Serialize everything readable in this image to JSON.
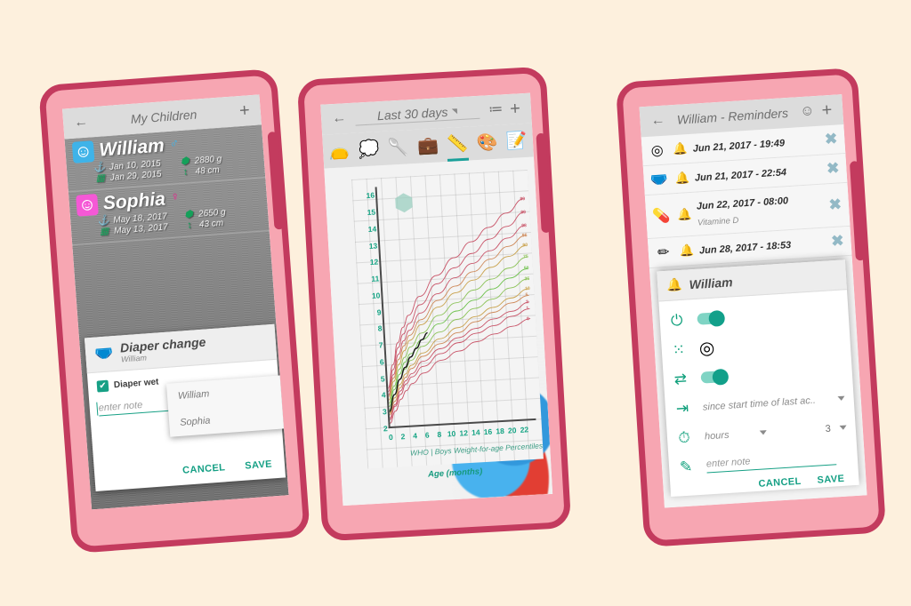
{
  "theme": {
    "background": "#FDF0DD",
    "phone_body": "#F7A6B2",
    "phone_border": "#C33B5E",
    "accent_teal": "#16A085",
    "accent_green": "#15A05A",
    "boy_blue": "#3FB3E8",
    "girl_pink": "#F558D6"
  },
  "phone1": {
    "appbar": {
      "back_icon": "←",
      "title": "My Children",
      "add_icon": "+"
    },
    "children": [
      {
        "avatar_icon": "baby-face-boy",
        "name": "William",
        "gender_symbol": "♂",
        "gender": "m",
        "birth_icon": "birth-icon",
        "birth_date": "Jan 10, 2015",
        "due_icon": "calendar-icon",
        "due_date": "Jan 29, 2015",
        "weight_icon": "weight-icon",
        "weight": "2880 g",
        "height_icon": "height-icon",
        "height": "48 cm"
      },
      {
        "avatar_icon": "baby-face-girl",
        "name": "Sophia",
        "gender_symbol": "♀",
        "gender": "f",
        "birth_icon": "birth-icon",
        "birth_date": "May 18, 2017",
        "due_icon": "calendar-icon",
        "due_date": "May 13, 2017",
        "weight_icon": "weight-icon",
        "weight": "2650 g",
        "height_icon": "height-icon",
        "height": "43 cm"
      }
    ],
    "dialog": {
      "icon": "diaper-icon",
      "title": "Diaper change",
      "subtitle": "William",
      "checkbox_label": "Diaper wet",
      "checkbox_checked": true,
      "check_glyph": "✔",
      "note_placeholder": "enter note",
      "tool_icons": [
        "baby-face-icon",
        "history-clock-icon"
      ],
      "cancel_label": "CANCEL",
      "save_label": "SAVE",
      "dropdown_options": [
        "William",
        "Sophia"
      ]
    }
  },
  "phone2": {
    "appbar": {
      "back_icon": "←",
      "title": "Last 30 days",
      "list_icon": "≔",
      "add_icon": "+"
    },
    "tabs": [
      {
        "name": "diaper-tab",
        "glyph": "👝"
      },
      {
        "name": "sleep-tab",
        "glyph": "💭"
      },
      {
        "name": "feeding-tab",
        "glyph": "🥄"
      },
      {
        "name": "health-tab",
        "glyph": "💼"
      },
      {
        "name": "measure-tab",
        "glyph": "📏",
        "active": true
      },
      {
        "name": "colors-tab",
        "glyph": "🎨"
      },
      {
        "name": "notes-tab",
        "glyph": "📝"
      }
    ],
    "chart_data": {
      "type": "line",
      "title": "WHO | Boys Weight-for-age Percentiles",
      "xlabel": "Age (months)",
      "ylabel": "",
      "xlim": [
        0,
        24
      ],
      "ylim": [
        2,
        16.5
      ],
      "xticks": [
        0,
        2,
        4,
        6,
        8,
        10,
        12,
        14,
        16,
        18,
        20,
        22
      ],
      "yticks": [
        2,
        3,
        4,
        5,
        6,
        7,
        8,
        9,
        10,
        11,
        12,
        13,
        14,
        15,
        16
      ],
      "grid": true,
      "legend_position": "right-edge",
      "watermark_icon": "weight-icon",
      "series": [
        {
          "name": "99.9th",
          "color": "#C9566A",
          "label": "99",
          "x": [
            0,
            1,
            2,
            3,
            4,
            6,
            9,
            12,
            15,
            18,
            21,
            24
          ],
          "values": [
            4.4,
            5.8,
            7.1,
            8.0,
            8.7,
            9.8,
            11.0,
            12.0,
            12.9,
            13.7,
            14.5,
            15.3
          ]
        },
        {
          "name": "99th",
          "color": "#C9566A",
          "label": "99",
          "x": [
            0,
            1,
            2,
            3,
            4,
            6,
            9,
            12,
            15,
            18,
            21,
            24
          ],
          "values": [
            4.2,
            5.5,
            6.8,
            7.6,
            8.2,
            9.3,
            10.5,
            11.4,
            12.2,
            13.0,
            13.7,
            14.5
          ]
        },
        {
          "name": "98th",
          "color": "#C9566A",
          "label": "98",
          "x": [
            0,
            1,
            2,
            3,
            4,
            6,
            9,
            12,
            15,
            18,
            21,
            24
          ],
          "values": [
            4.0,
            5.2,
            6.4,
            7.2,
            7.8,
            8.8,
            9.9,
            10.8,
            11.6,
            12.3,
            13.0,
            13.7
          ]
        },
        {
          "name": "95th",
          "color": "#CE8A5A",
          "label": "95",
          "x": [
            0,
            1,
            2,
            3,
            4,
            6,
            9,
            12,
            15,
            18,
            21,
            24
          ],
          "values": [
            3.9,
            5.0,
            6.1,
            6.9,
            7.5,
            8.4,
            9.5,
            10.3,
            11.1,
            11.8,
            12.5,
            13.1
          ]
        },
        {
          "name": "90th",
          "color": "#C9A34E",
          "label": "90",
          "x": [
            0,
            1,
            2,
            3,
            4,
            6,
            9,
            12,
            15,
            18,
            21,
            24
          ],
          "values": [
            3.7,
            4.8,
            5.8,
            6.6,
            7.2,
            8.1,
            9.1,
            9.9,
            10.6,
            11.3,
            11.9,
            12.5
          ]
        },
        {
          "name": "75th",
          "color": "#8DC35A",
          "label": "75",
          "x": [
            0,
            1,
            2,
            3,
            4,
            6,
            9,
            12,
            15,
            18,
            21,
            24
          ],
          "values": [
            3.5,
            4.5,
            5.5,
            6.2,
            6.8,
            7.6,
            8.6,
            9.3,
            10.0,
            10.6,
            11.2,
            11.8
          ]
        },
        {
          "name": "50th",
          "color": "#6FC24E",
          "label": "50",
          "x": [
            0,
            1,
            2,
            3,
            4,
            6,
            9,
            12,
            15,
            18,
            21,
            24
          ],
          "values": [
            3.3,
            4.3,
            5.2,
            5.9,
            6.4,
            7.2,
            8.1,
            8.8,
            9.4,
            10.0,
            10.6,
            11.1
          ]
        },
        {
          "name": "25th",
          "color": "#8DC35A",
          "label": "25",
          "x": [
            0,
            1,
            2,
            3,
            4,
            6,
            9,
            12,
            15,
            18,
            21,
            24
          ],
          "values": [
            3.1,
            4.0,
            4.9,
            5.5,
            6.0,
            6.8,
            7.6,
            8.3,
            8.9,
            9.4,
            10.0,
            10.5
          ]
        },
        {
          "name": "10th",
          "color": "#C9A34E",
          "label": "10",
          "x": [
            0,
            1,
            2,
            3,
            4,
            6,
            9,
            12,
            15,
            18,
            21,
            24
          ],
          "values": [
            2.9,
            3.8,
            4.6,
            5.2,
            5.7,
            6.4,
            7.2,
            7.8,
            8.4,
            8.9,
            9.4,
            9.9
          ]
        },
        {
          "name": "5th",
          "color": "#CE8A5A",
          "label": "5",
          "x": [
            0,
            1,
            2,
            3,
            4,
            6,
            9,
            12,
            15,
            18,
            21,
            24
          ],
          "values": [
            2.8,
            3.6,
            4.4,
            5.0,
            5.5,
            6.2,
            6.9,
            7.5,
            8.1,
            8.6,
            9.1,
            9.5
          ]
        },
        {
          "name": "2nd",
          "color": "#C9566A",
          "label": "2",
          "x": [
            0,
            1,
            2,
            3,
            4,
            6,
            9,
            12,
            15,
            18,
            21,
            24
          ],
          "values": [
            2.6,
            3.4,
            4.2,
            4.8,
            5.2,
            5.9,
            6.6,
            7.2,
            7.7,
            8.2,
            8.6,
            9.1
          ]
        },
        {
          "name": "1st",
          "color": "#C9566A",
          "label": "1",
          "x": [
            0,
            1,
            2,
            3,
            4,
            6,
            9,
            12,
            15,
            18,
            21,
            24
          ],
          "values": [
            2.5,
            3.3,
            4.0,
            4.6,
            5.0,
            5.6,
            6.3,
            6.9,
            7.4,
            7.8,
            8.3,
            8.7
          ]
        },
        {
          "name": "0.1th",
          "color": "#C9566A",
          "label": "0",
          "x": [
            0,
            1,
            2,
            3,
            4,
            6,
            9,
            12,
            15,
            18,
            21,
            24
          ],
          "values": [
            2.3,
            3.0,
            3.7,
            4.2,
            4.6,
            5.2,
            5.9,
            6.4,
            6.9,
            7.3,
            7.7,
            8.1
          ]
        },
        {
          "name": "child",
          "color": "#1A1A1A",
          "label": "",
          "x": [
            0,
            1,
            2,
            3,
            4,
            5,
            6,
            7
          ],
          "values": [
            3.0,
            4.0,
            4.9,
            5.6,
            6.2,
            6.7,
            7.2,
            7.6
          ]
        }
      ]
    }
  },
  "phone3": {
    "appbar": {
      "back_icon": "←",
      "title": "William - Reminders",
      "child_icon": "baby-face-icon",
      "add_icon": "+"
    },
    "reminders": [
      {
        "icon": "nursing-icon",
        "bell": "bell-icon",
        "date": "Jun 21, 2017 - 19:49",
        "note": "",
        "close": "✖"
      },
      {
        "icon": "diaper-icon",
        "bell": "bell-icon",
        "date": "Jun 21, 2017 - 22:54",
        "note": "",
        "close": "✖"
      },
      {
        "icon": "medicine-icon",
        "bell": "bell-icon",
        "date": "Jun 22, 2017 - 08:00",
        "note": "Vitamine D",
        "close": "✖"
      },
      {
        "icon": "pencil-icon",
        "bell": "bell-icon",
        "date": "Jun 28, 2017 - 18:53",
        "note": "",
        "close": "✖"
      }
    ],
    "sheet": {
      "header_icon": "alarm-bell-icon",
      "header_title": "William",
      "rows": [
        {
          "icon": "power-icon",
          "control": "toggle",
          "value_on": true
        },
        {
          "icon": "grid-icon",
          "control": "circle-icon",
          "value": "nursing-icon"
        },
        {
          "icon": "repeat-icon",
          "control": "toggle",
          "value_on": true
        },
        {
          "icon": "interval-icon",
          "control": "select",
          "value": "since start time of last ac..",
          "caret": "▾"
        },
        {
          "icon": "stopwatch-icon",
          "control": "select-pair",
          "unit": "hours",
          "unit_caret": "▾",
          "amount": "3",
          "amount_caret": "▾"
        },
        {
          "icon": "pencil-icon",
          "control": "note",
          "placeholder": "enter note"
        }
      ],
      "cancel_label": "CANCEL",
      "save_label": "SAVE"
    }
  }
}
